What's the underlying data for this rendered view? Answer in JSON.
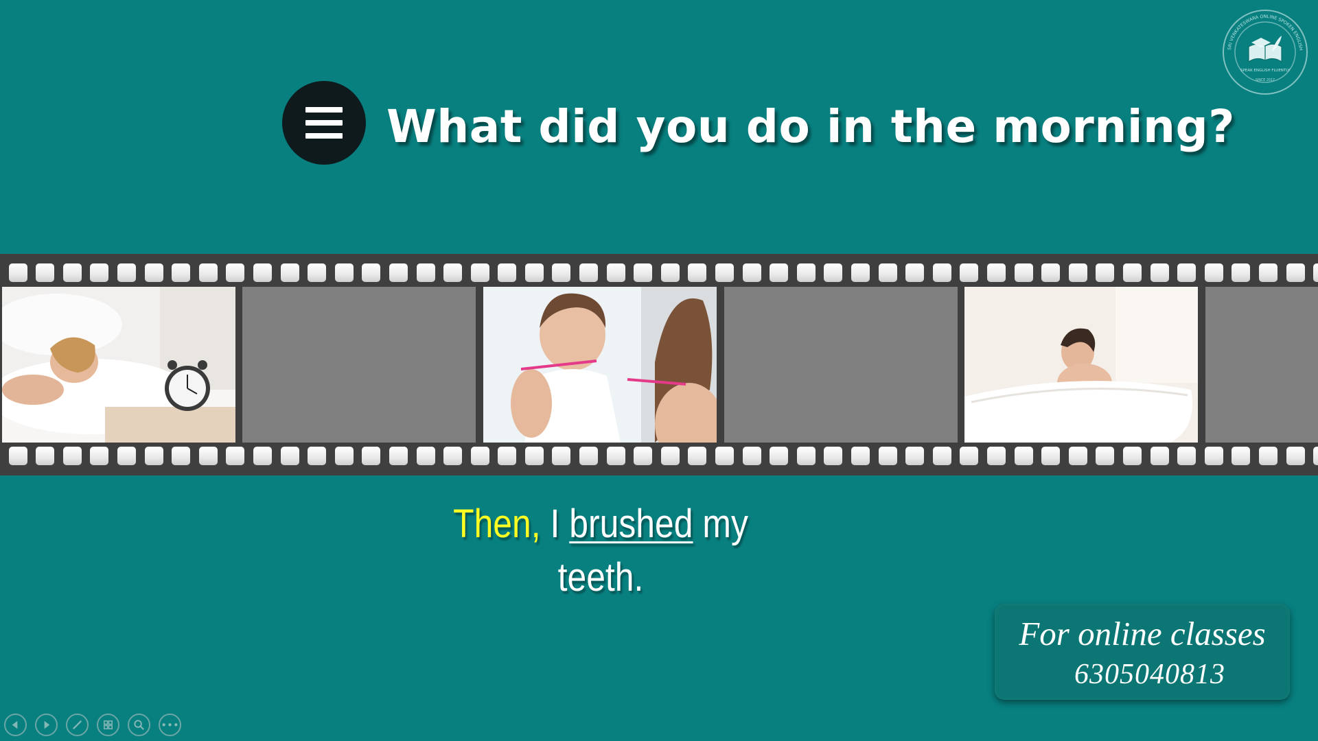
{
  "header": {
    "title": "What did you do in the morning?",
    "menu_icon": "hamburger-menu-icon"
  },
  "logo": {
    "icon": "school-logo-book-graduation-cap",
    "ring_text": "SRI VENKATESWARA ONLINE SPOKEN ENGLISH SCHOOL",
    "tagline": "SPEAK ENGLISH FLUENTLY",
    "since": "SINCE 2017"
  },
  "film_strip": {
    "frames": [
      {
        "content": "woman-in-bed-alarm-clock-photo"
      },
      {
        "content": "empty-gray-frame"
      },
      {
        "content": "woman-brushing-teeth-photo"
      },
      {
        "content": "empty-gray-frame"
      },
      {
        "content": "woman-in-bathtub-photo"
      },
      {
        "content": "empty-gray-frame"
      }
    ]
  },
  "caption": {
    "highlight": "Then,",
    "word1": "I",
    "verb": "brushed",
    "word2": "my",
    "line2": "teeth."
  },
  "promo": {
    "line1": "For online classes",
    "line2": "6305040813"
  },
  "toolbar": {
    "buttons": [
      "previous-slide-icon",
      "next-slide-icon",
      "pen-icon",
      "slides-grid-icon",
      "zoom-icon",
      "more-options-icon"
    ],
    "more_label": "•••"
  },
  "colors": {
    "background": "#088080",
    "caption_highlight": "#ffff22",
    "film_dark": "#3f3f3f",
    "empty_frame": "#808080"
  }
}
